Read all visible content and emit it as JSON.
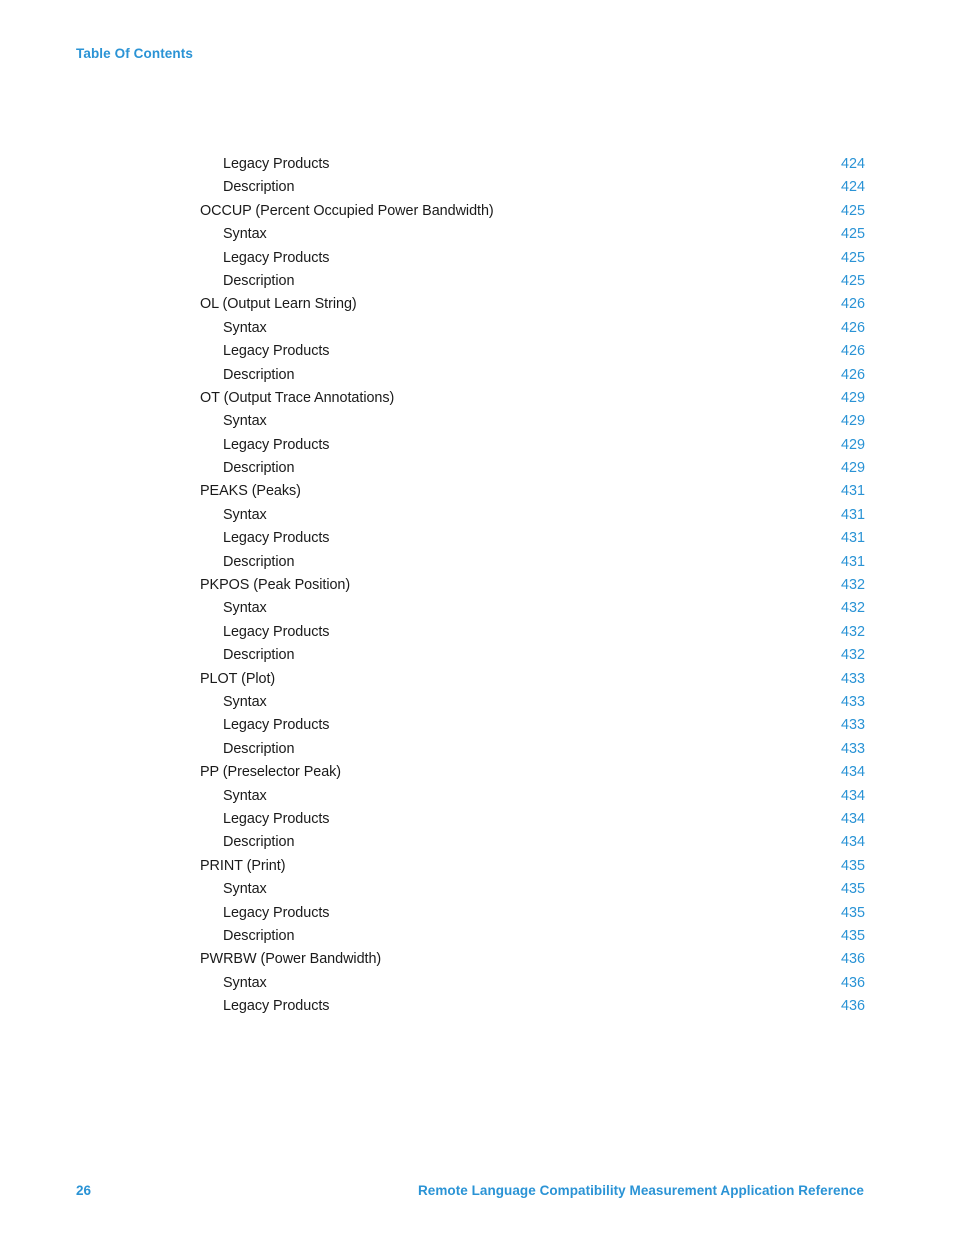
{
  "header": {
    "label": "Table Of Contents"
  },
  "colors": {
    "accent_blue": "#2a93d5",
    "body_text": "#1a1a1a",
    "page_background": "#ffffff"
  },
  "toc": {
    "entries": [
      {
        "title": "Legacy Products",
        "page": "424",
        "level": 2
      },
      {
        "title": "Description",
        "page": "424",
        "level": 2
      },
      {
        "title": "OCCUP (Percent Occupied Power Bandwidth)",
        "page": "425",
        "level": 1
      },
      {
        "title": "Syntax",
        "page": "425",
        "level": 2
      },
      {
        "title": "Legacy Products",
        "page": "425",
        "level": 2
      },
      {
        "title": "Description",
        "page": "425",
        "level": 2
      },
      {
        "title": "OL (Output Learn String)",
        "page": "426",
        "level": 1
      },
      {
        "title": "Syntax",
        "page": "426",
        "level": 2
      },
      {
        "title": "Legacy Products",
        "page": "426",
        "level": 2
      },
      {
        "title": "Description",
        "page": "426",
        "level": 2
      },
      {
        "title": "OT (Output Trace Annotations)",
        "page": "429",
        "level": 1
      },
      {
        "title": "Syntax",
        "page": "429",
        "level": 2
      },
      {
        "title": "Legacy Products",
        "page": "429",
        "level": 2
      },
      {
        "title": "Description",
        "page": "429",
        "level": 2
      },
      {
        "title": "PEAKS (Peaks)",
        "page": "431",
        "level": 1
      },
      {
        "title": "Syntax",
        "page": "431",
        "level": 2
      },
      {
        "title": "Legacy Products",
        "page": "431",
        "level": 2
      },
      {
        "title": "Description",
        "page": "431",
        "level": 2
      },
      {
        "title": "PKPOS (Peak Position)",
        "page": "432",
        "level": 1
      },
      {
        "title": "Syntax",
        "page": "432",
        "level": 2
      },
      {
        "title": "Legacy Products",
        "page": "432",
        "level": 2
      },
      {
        "title": "Description",
        "page": "432",
        "level": 2
      },
      {
        "title": "PLOT (Plot)",
        "page": "433",
        "level": 1
      },
      {
        "title": "Syntax",
        "page": "433",
        "level": 2
      },
      {
        "title": "Legacy Products",
        "page": "433",
        "level": 2
      },
      {
        "title": "Description",
        "page": "433",
        "level": 2
      },
      {
        "title": "PP (Preselector Peak)",
        "page": "434",
        "level": 1
      },
      {
        "title": "Syntax",
        "page": "434",
        "level": 2
      },
      {
        "title": "Legacy Products",
        "page": "434",
        "level": 2
      },
      {
        "title": "Description",
        "page": "434",
        "level": 2
      },
      {
        "title": "PRINT (Print)",
        "page": "435",
        "level": 1
      },
      {
        "title": "Syntax",
        "page": "435",
        "level": 2
      },
      {
        "title": "Legacy Products",
        "page": "435",
        "level": 2
      },
      {
        "title": "Description",
        "page": "435",
        "level": 2
      },
      {
        "title": "PWRBW (Power Bandwidth)",
        "page": "436",
        "level": 1
      },
      {
        "title": "Syntax",
        "page": "436",
        "level": 2
      },
      {
        "title": "Legacy Products",
        "page": "436",
        "level": 2
      }
    ]
  },
  "footer": {
    "page_number": "26",
    "document_title": "Remote Language Compatibility Measurement Application Reference"
  }
}
